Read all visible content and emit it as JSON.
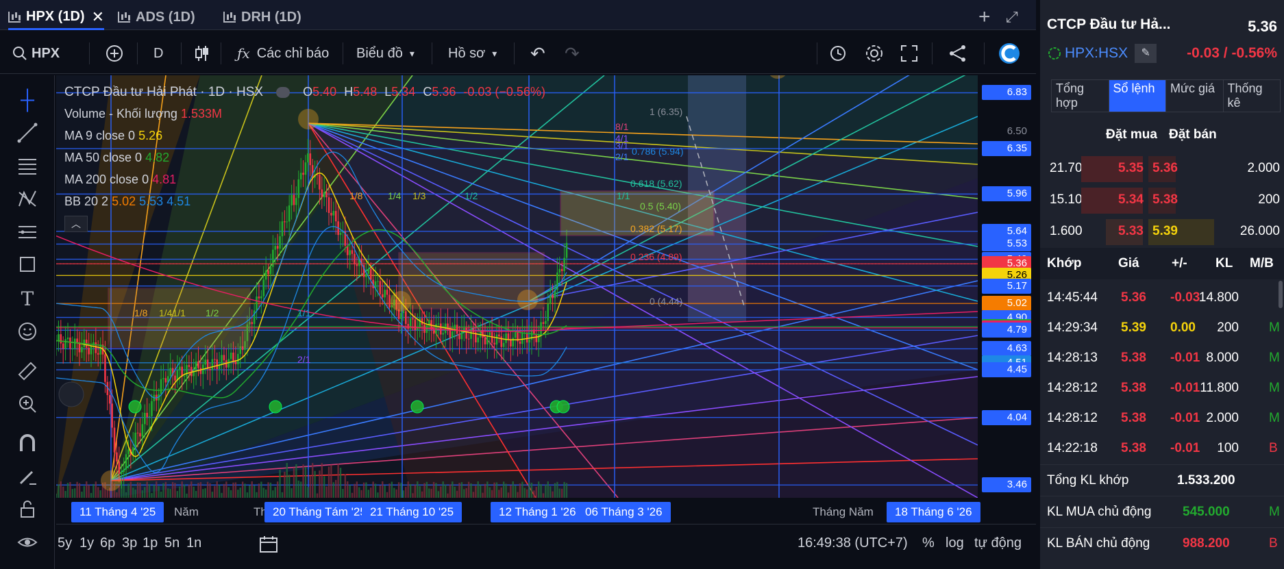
{
  "tabs": [
    {
      "label": "HPX (1D)",
      "active": true
    },
    {
      "label": "ADS (1D)",
      "active": false
    },
    {
      "label": "DRH (1D)",
      "active": false
    }
  ],
  "tab_close": "✕",
  "toolbar": {
    "symbol": "HPX",
    "interval": "D",
    "indicators": "Các chỉ báo",
    "chart_type": "Biểu đồ",
    "profile": "Hồ sơ"
  },
  "legend": {
    "title": "CTCP Đầu tư Hải Phát · 1D · HSX",
    "o": "5.40",
    "h": "5.48",
    "l": "5.34",
    "c": "5.36",
    "chg": "-0.03 (−0.56%)",
    "volume_label": "Volume - Khối lượng",
    "volume_value": "1.533M",
    "ma9_label": "MA 9 close 0",
    "ma9_value": "5.26",
    "ma50_label": "MA 50 close 0",
    "ma50_value": "4.82",
    "ma200_label": "MA 200 close 0",
    "ma200_value": "4.81",
    "bb_label": "BB 20 2",
    "bb_v1": "5.02",
    "bb_v2": "5.53",
    "bb_v3": "4.51"
  },
  "fib_labels": {
    "f1": "1 (6.35)",
    "f786": "0.786 (5.94)",
    "f618": "0.618 (5.62)",
    "f5": "0.5 (5.40)",
    "f382": "0.382 (5.17)",
    "f236": "0.236 (4.89)",
    "f0": "0 (4.44)"
  },
  "gann_labels": {
    "g18a": "1/8",
    "g14": "1/4",
    "g13": "1/3",
    "g12": "1/2",
    "g11": "1/1",
    "g18b": "1/8",
    "g1141": "1/41/1",
    "g12b": "1/2",
    "g11b": "1/1",
    "g81": "8/1",
    "g41": "4/1",
    "g31": "3/1",
    "g21": "2/1",
    "g11c": "1/1",
    "g21b": "2/1"
  },
  "price_axis": [
    {
      "v": "6.83",
      "c": "#2962ff",
      "p": 6.83
    },
    {
      "v": "6.50",
      "c": "",
      "p": 6.5
    },
    {
      "v": "6.35",
      "c": "#2962ff",
      "p": 6.35
    },
    {
      "v": "5.96",
      "c": "#2962ff",
      "p": 5.96
    },
    {
      "v": "5.64",
      "c": "#2962ff",
      "p": 5.64
    },
    {
      "v": "5.53",
      "c": "#2962ff",
      "p": 5.53
    },
    {
      "v": "5.40",
      "c": "#2962ff",
      "p": 5.4
    },
    {
      "v": "5.36",
      "c": "#f23645",
      "p": 5.36
    },
    {
      "v": "5.26",
      "c": "#f5d30b",
      "p": 5.26
    },
    {
      "v": "5.17",
      "c": "#2962ff",
      "p": 5.17
    },
    {
      "v": "5.02",
      "c": "#f57c00",
      "p": 5.02
    },
    {
      "v": "4.90",
      "c": "#2962ff",
      "p": 4.9
    },
    {
      "v": "4.82",
      "c": "#22ab2e",
      "p": 4.82
    },
    {
      "v": "4.81",
      "c": "#e91e63",
      "p": 4.81
    },
    {
      "v": "4.79",
      "c": "#2962ff",
      "p": 4.79
    },
    {
      "v": "4.63",
      "c": "#2962ff",
      "p": 4.63
    },
    {
      "v": "4.51",
      "c": "#1e88e5",
      "p": 4.51
    },
    {
      "v": "4.45",
      "c": "#2962ff",
      "p": 4.45
    },
    {
      "v": "4.04",
      "c": "#2962ff",
      "p": 4.04
    },
    {
      "v": "3.46",
      "c": "#2962ff",
      "p": 3.46
    }
  ],
  "time_axis": {
    "d1": "11 Tháng 4 '25",
    "t_nam": "Năm",
    "t7": "Tháng 7",
    "d2": "20 Tháng Tám '25",
    "d3": "21 Tháng 10 '25",
    "d4": "12 Tháng 1 '26",
    "d5": "06 Tháng 3 '26",
    "t_nam2": "Tháng Năm",
    "d6": "18 Tháng 6 '26"
  },
  "ranges": [
    "5y",
    "1y",
    "6p",
    "3p",
    "1p",
    "5n",
    "1n"
  ],
  "bottom": {
    "time": "16:49:38 (UTC+7)",
    "pct": "%",
    "log": "log",
    "auto": "tự động"
  },
  "right": {
    "company": "CTCP Đầu tư Hả...",
    "price": "5.36",
    "ticker": "HPX:HSX",
    "change": "-0.03 / -0.56%",
    "tabs": [
      "Tổng hợp",
      "Sổ lệnh",
      "Mức giá",
      "Thống kê"
    ],
    "ob_head_buy": "Đặt mua",
    "ob_head_sell": "Đặt bán",
    "orderbook": [
      {
        "bq": "21.700",
        "bp": "5.35",
        "ap": "5.36",
        "aq": "2.000",
        "bpc": "red",
        "apc": "red"
      },
      {
        "bq": "15.100",
        "bp": "5.34",
        "ap": "5.38",
        "aq": "200",
        "bpc": "red",
        "apc": "red"
      },
      {
        "bq": "1.600",
        "bp": "5.33",
        "ap": "5.39",
        "aq": "26.000",
        "bpc": "red",
        "apc": "yellow"
      }
    ],
    "trade_head": [
      "Khớp",
      "Giá",
      "+/-",
      "KL",
      "M/B"
    ],
    "trades": [
      {
        "t": "14:45:44",
        "p": "5.36",
        "d": "-0.03",
        "v": "14.800",
        "s": "",
        "c": "red"
      },
      {
        "t": "14:29:34",
        "p": "5.39",
        "d": "0.00",
        "v": "200",
        "s": "M",
        "c": "yellow"
      },
      {
        "t": "14:28:13",
        "p": "5.38",
        "d": "-0.01",
        "v": "8.000",
        "s": "M",
        "c": "red"
      },
      {
        "t": "14:28:12",
        "p": "5.38",
        "d": "-0.01",
        "v": "11.800",
        "s": "M",
        "c": "red"
      },
      {
        "t": "14:28:12",
        "p": "5.38",
        "d": "-0.01",
        "v": "2.000",
        "s": "M",
        "c": "red"
      },
      {
        "t": "14:22:18",
        "p": "5.38",
        "d": "-0.01",
        "v": "100",
        "s": "B",
        "c": "red"
      }
    ],
    "summary": [
      {
        "label": "Tổng KL khớp",
        "value": "1.533.200",
        "side": "",
        "c": "white"
      },
      {
        "label": "KL MUA chủ động",
        "value": "545.000",
        "side": "M",
        "c": "green"
      },
      {
        "label": "KL BÁN chủ động",
        "value": "988.200",
        "side": "B",
        "c": "red"
      }
    ]
  },
  "colors": {
    "accent": "#2962ff",
    "up": "#22ab2e",
    "down": "#f23645",
    "ref": "#f5d30b"
  }
}
